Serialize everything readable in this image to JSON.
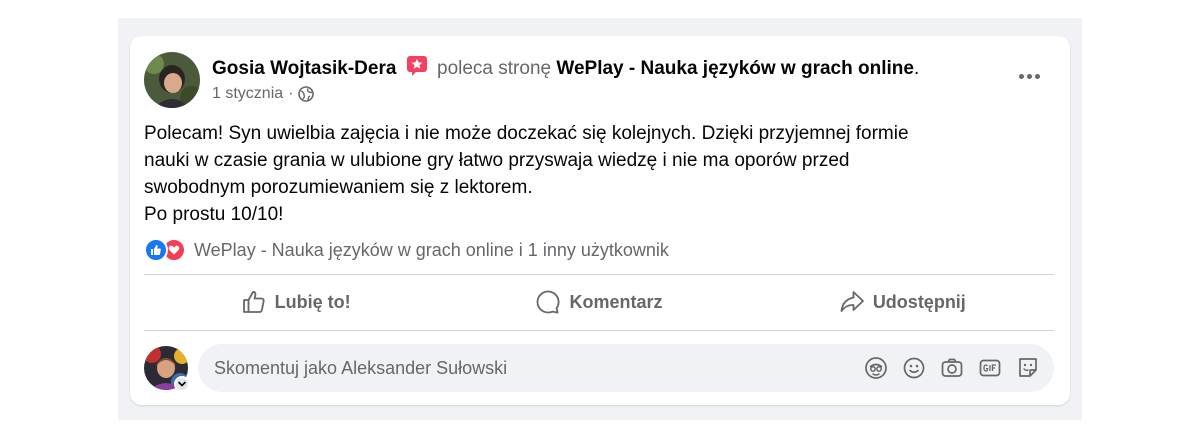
{
  "post": {
    "author": "Gosia Wojtasik-Dera",
    "verb": "poleca stronę",
    "page_name": "WePlay - Nauka języków w grach online",
    "trailing_dot": ".",
    "date": "1 stycznia",
    "separator": "·",
    "text_lines": [
      "Polecam! Syn uwielbia zajęcia i nie może doczekać się kolejnych. Dzięki przyjemnej formie",
      "nauki w czasie grania w ulubione gry łatwo przyswaja wiedzę i nie ma oporów przed",
      "swobodnym porozumiewaniem się z lektorem.",
      "Po prostu 10/10!"
    ]
  },
  "reactions": {
    "types": [
      "like",
      "love"
    ],
    "summary": "WePlay - Nauka języków w grach online i 1 inny użytkownik"
  },
  "actions": {
    "like_label": "Lubię to!",
    "comment_label": "Komentarz",
    "share_label": "Udostępnij"
  },
  "comment": {
    "placeholder": "Skomentuj jako Aleksander Sułowski",
    "tools": [
      "avatar-sticker-icon",
      "emoji-icon",
      "camera-icon",
      "gif-icon",
      "sticker-icon"
    ]
  },
  "colors": {
    "background": "#f0f2f5",
    "text_secondary": "#65676b",
    "like_blue": "#1877f2",
    "love_red": "#f33e58",
    "recommend_badge": "#f3425f"
  },
  "icons": {
    "recommend": "recommend-badge-icon",
    "audience": "globe-icon",
    "more": "more-options-icon"
  }
}
